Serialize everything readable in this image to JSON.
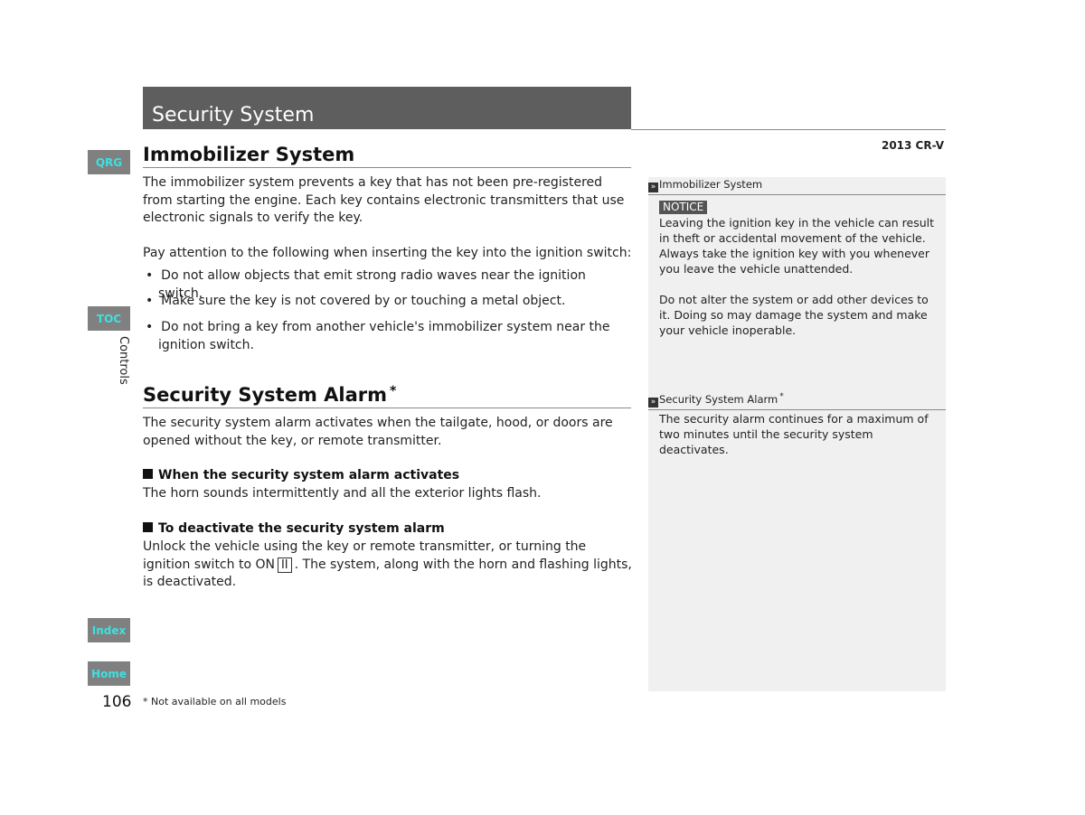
{
  "header": {
    "section_title": "Security System",
    "model": "2013 CR-V"
  },
  "nav": {
    "qrg": "QRG",
    "toc": "TOC",
    "index": "Index",
    "home": "Home",
    "chapter_label": "Controls"
  },
  "main": {
    "immobilizer": {
      "heading": "Immobilizer System",
      "intro": "The immobilizer system prevents a key that has not been pre-registered from starting the engine. Each key contains electronic transmitters that use electronic signals to verify the key.",
      "attention": "Pay attention to the following when inserting the key into the ignition switch:",
      "bullets": [
        "Do not allow objects that emit strong radio waves near the ignition switch.",
        "Make sure the key is not covered by or touching a metal object.",
        "Do not bring a key from another vehicle's immobilizer system near the ignition switch."
      ]
    },
    "alarm": {
      "heading": "Security System Alarm",
      "asterisk": "*",
      "intro": "The security system alarm activates when the tailgate, hood, or doors are opened without the key, or remote transmitter.",
      "sub1_title": "When the security system alarm activates",
      "sub1_text": "The horn sounds intermittently and all the exterior lights flash.",
      "sub2_title": "To deactivate the security system alarm",
      "sub2_text_before": "Unlock the vehicle using the key or remote transmitter, or turning the ignition switch to ON",
      "sub2_key": "II",
      "sub2_text_after": ". The system, along with the horn and flashing lights, is deactivated."
    }
  },
  "sidebar": {
    "arrow_icon": "»",
    "immobilizer_ref": "Immobilizer System",
    "notice_label": "NOTICE",
    "notice_p1": "Leaving the ignition key in the vehicle can result in theft or accidental movement of the vehicle.",
    "notice_p2": "Always take the ignition key with you whenever you leave the vehicle unattended.",
    "notice_p3": "Do not alter the system or add other devices to it. Doing so may damage the system and make your vehicle inoperable.",
    "alarm_ref": "Security System Alarm",
    "alarm_asterisk": "*",
    "alarm_text": "The security alarm continues for a maximum of two minutes until the security system deactivates."
  },
  "footer": {
    "page_number": "106",
    "footnote": "* Not available on all models"
  }
}
